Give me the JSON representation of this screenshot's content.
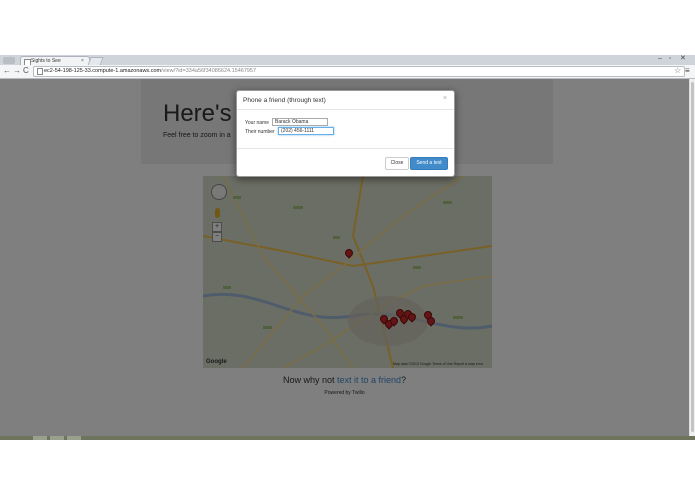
{
  "browser": {
    "tab_title": "Sights to See",
    "tab_close": "×",
    "url_host": "ec2-54-198-125-33.compute-1.amazonaws.com",
    "url_path": "/view/?id=334a56f34086624.15467957",
    "window_controls": {
      "minimize": "–",
      "maximize": "▫",
      "close": "✕"
    },
    "nav_icons": {
      "back": "←",
      "forward": "→",
      "reload": "C",
      "star": "☆",
      "menu": "≡"
    }
  },
  "page": {
    "heading": "Here's t",
    "subtext": "Feel free to zoom in a",
    "map": {
      "zoom_in": "+",
      "zoom_out": "−",
      "logo": "Google",
      "attribution": "Map data ©2013 Google  Terms of Use  Report a map error"
    },
    "cta_prefix": "Now why not ",
    "cta_link": "text it to a friend",
    "cta_suffix": "?",
    "footer": "Powered by Twilio"
  },
  "modal": {
    "title": "Phone a friend (through text)",
    "close_x": "×",
    "name_label": "Your name",
    "name_value": "Barack Obama",
    "number_label": "Their number",
    "number_value": "(202) 456-1111",
    "close_button": "Close",
    "send_button": "Send a text"
  },
  "colors": {
    "primary_button": "#428bca",
    "link": "#428bca",
    "map_marker": "#c62828"
  }
}
